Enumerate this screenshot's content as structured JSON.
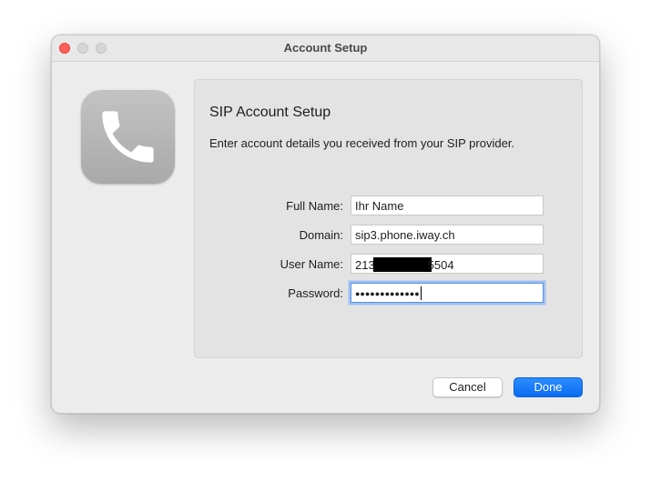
{
  "window": {
    "title": "Account Setup"
  },
  "app_icon": {
    "name": "phone-icon"
  },
  "panel": {
    "heading": "SIP Account Setup",
    "subtitle": "Enter account details you received from your SIP provider."
  },
  "form": {
    "full_name": {
      "label": "Full Name:",
      "value": "Ihr Name"
    },
    "domain": {
      "label": "Domain:",
      "value": "sip3.phone.iway.ch"
    },
    "user_name": {
      "label": "User Name:",
      "value_prefix": "213",
      "value_suffix": "5504"
    },
    "password": {
      "label": "Password:",
      "value": "●●●●●●●●●●●●●"
    }
  },
  "buttons": {
    "cancel": "Cancel",
    "done": "Done"
  },
  "colors": {
    "close": "#fe5f57",
    "accent": "#0a6cf0",
    "focus_ring": "#9fc0f2"
  }
}
